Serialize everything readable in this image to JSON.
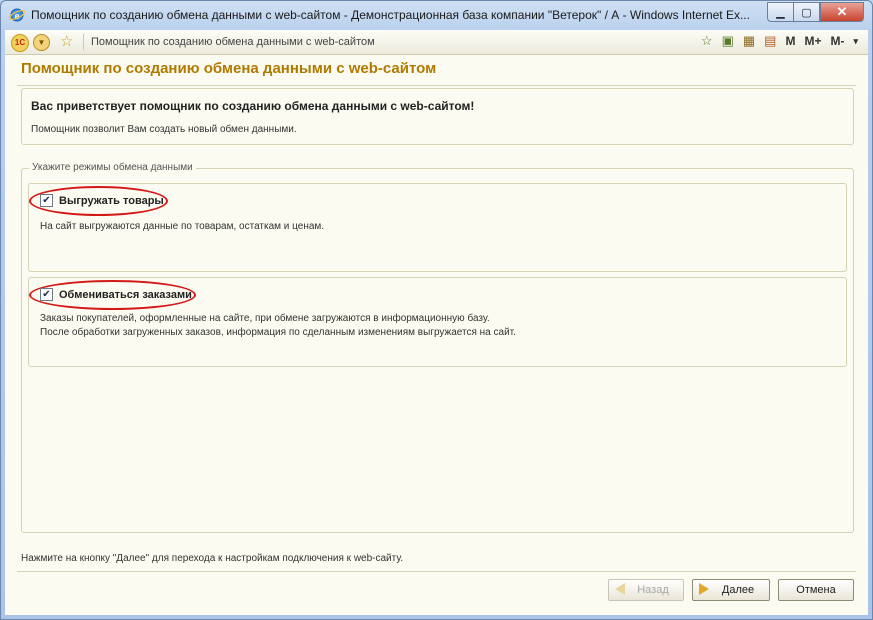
{
  "window": {
    "title": "Помощник по созданию обмена данными с web-сайтом - Демонстрационная база компании \"Ветерок\" / А - Windows Internet Ex..."
  },
  "toolbar": {
    "caption": "Помощник по созданию обмена данными с web-сайтом",
    "logo": "1С",
    "m_label": "M",
    "m_plus_label": "M+",
    "m_minus_label": "M-"
  },
  "page": {
    "title": "Помощник по созданию обмена данными с web-сайтом",
    "welcome_heading": "Вас приветствует помощник по созданию обмена данными с web-сайтом!",
    "welcome_text": "Помощник позволит Вам создать новый обмен данными.",
    "group_label": "Укажите режимы обмена данными",
    "options": [
      {
        "label": "Выгружать товары",
        "checked": true,
        "description": [
          "На сайт выгружаются данные по товарам, остаткам и ценам."
        ]
      },
      {
        "label": "Обмениваться заказами",
        "checked": true,
        "description": [
          "Заказы покупателей, оформленные на сайте, при обмене загружаются в информационную базу.",
          "После обработки загруженных заказов, информация по сделанным изменениям выгружается на сайт."
        ]
      }
    ],
    "hint": "Нажмите на кнопку \"Далее\" для перехода к настройкам подключения к web-сайту."
  },
  "buttons": {
    "back": "Назад",
    "next": "Далее",
    "cancel": "Отмена"
  },
  "colors": {
    "title_accent": "#b07a00",
    "highlight_ring": "#d41818"
  }
}
